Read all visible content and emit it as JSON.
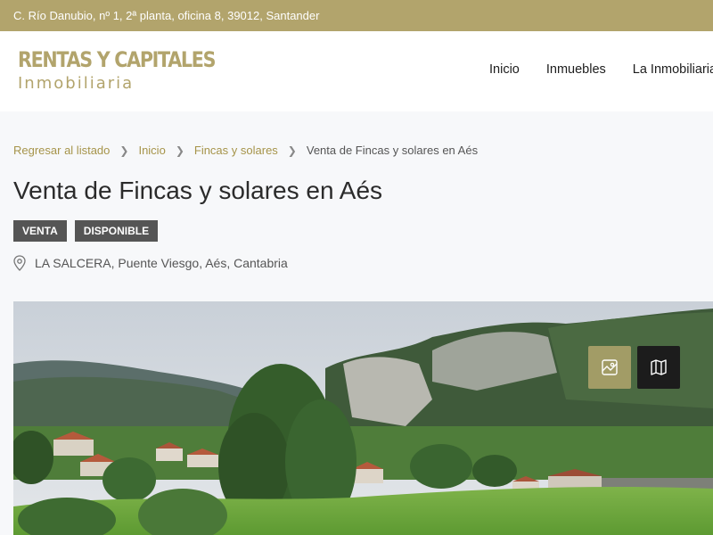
{
  "topbar": {
    "address": "C. Río Danubio, nº 1, 2ª planta, oficina 8, 39012, Santander"
  },
  "logo": {
    "line1": "RENTAS Y CAPITALES",
    "line2": "Inmobiliaria"
  },
  "nav": {
    "items": [
      "Inicio",
      "Inmuebles",
      "La Inmobiliaria"
    ]
  },
  "breadcrumb": {
    "back": "Regresar al listado",
    "home": "Inicio",
    "category": "Fincas y solares",
    "current": "Venta de Fincas y solares en Aés"
  },
  "listing": {
    "title": "Venta de Fincas y solares en Aés",
    "badges": [
      "VENTA",
      "DISPONIBLE"
    ],
    "address": "LA SALCERA, Puente Viesgo, Aés, Cantabria"
  },
  "photo": {
    "buttons": [
      "gallery-icon",
      "map-icon"
    ]
  },
  "colors": {
    "brand": "#b2a46c",
    "link": "#a6944a",
    "badge": "#555555",
    "dark_button": "#1c1c1c"
  }
}
